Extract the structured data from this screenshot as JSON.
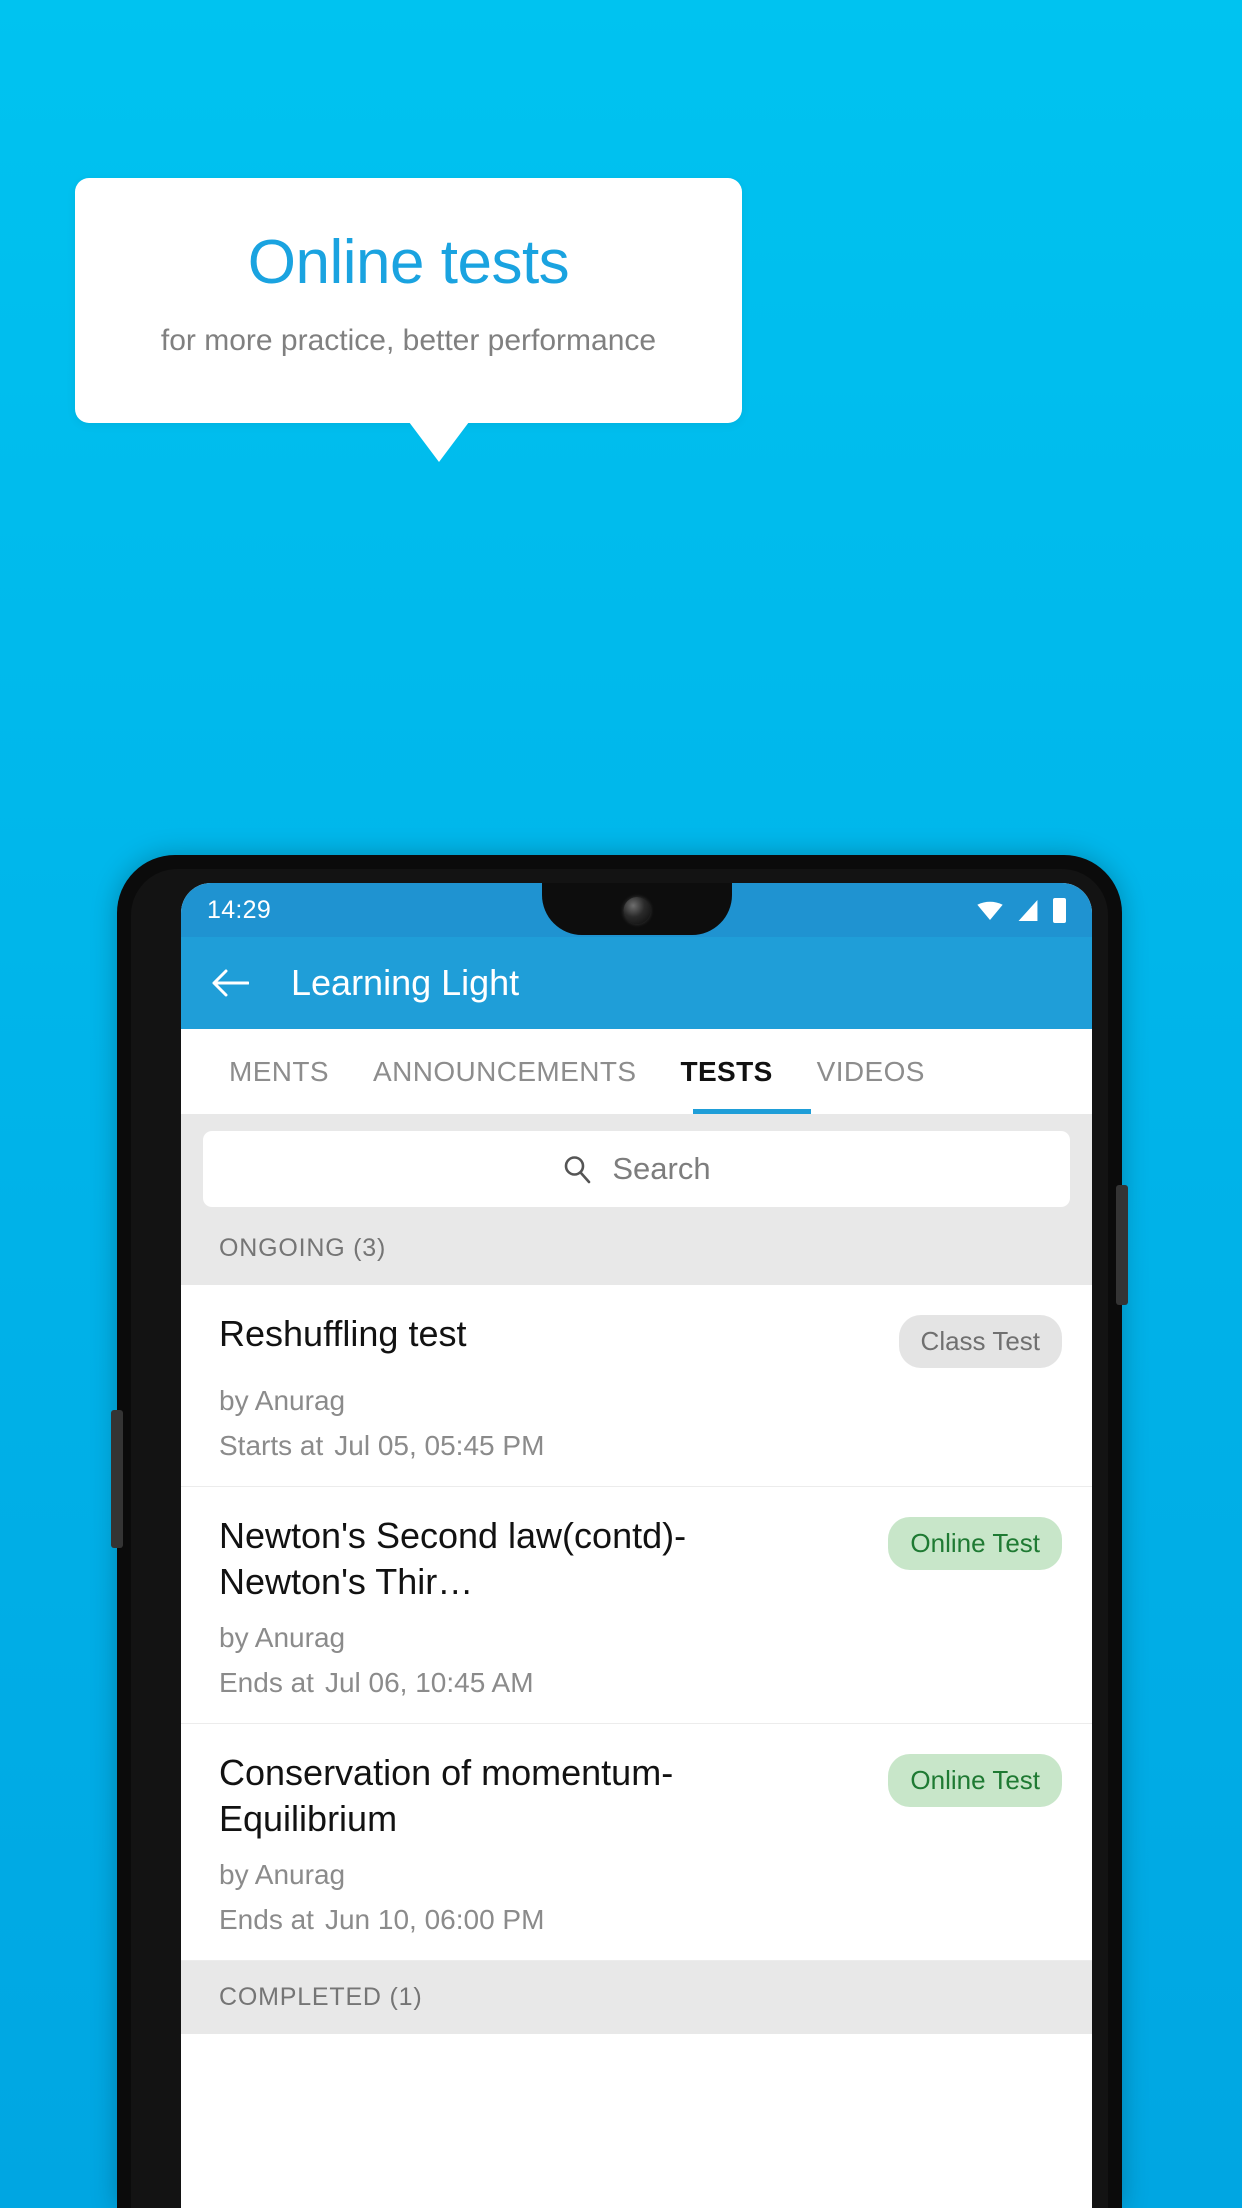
{
  "promo": {
    "title": "Online tests",
    "subtitle": "for more practice, better performance"
  },
  "colors": {
    "background_top": "#00c3f0",
    "background_bottom": "#00a6e2",
    "accent": "#1f9ed8",
    "statusbar": "#1f93d1",
    "badge_gray_bg": "#e4e4e4",
    "badge_green_bg": "#c8e6c9",
    "badge_green_text": "#1f7a33"
  },
  "phone": {
    "statusbar": {
      "time": "14:29",
      "icons": [
        "wifi-icon",
        "signal-icon",
        "battery-icon"
      ]
    },
    "appbar": {
      "back_icon": "back-arrow-icon",
      "title": "Learning Light"
    },
    "tabs": [
      {
        "label": "MENTS",
        "active": false
      },
      {
        "label": "ANNOUNCEMENTS",
        "active": false
      },
      {
        "label": "TESTS",
        "active": true
      },
      {
        "label": "VIDEOS",
        "active": false
      }
    ],
    "search": {
      "icon": "search-icon",
      "placeholder": "Search",
      "value": ""
    },
    "sections": [
      {
        "header": "ONGOING (3)"
      },
      {
        "header": "COMPLETED (1)"
      }
    ],
    "tests": [
      {
        "title": "Reshuffling test",
        "badge": "Class Test",
        "badge_style": "gray",
        "author": "by Anurag",
        "time_label": "Starts at",
        "time_value": "Jul 05, 05:45 PM"
      },
      {
        "title": "Newton's Second law(contd)-Newton's Thir…",
        "badge": "Online Test",
        "badge_style": "green",
        "author": "by Anurag",
        "time_label": "Ends at",
        "time_value": "Jul 06, 10:45 AM"
      },
      {
        "title": "Conservation of momentum-Equilibrium",
        "badge": "Online Test",
        "badge_style": "green",
        "author": "by Anurag",
        "time_label": "Ends at",
        "time_value": "Jun 10, 06:00 PM"
      }
    ]
  }
}
